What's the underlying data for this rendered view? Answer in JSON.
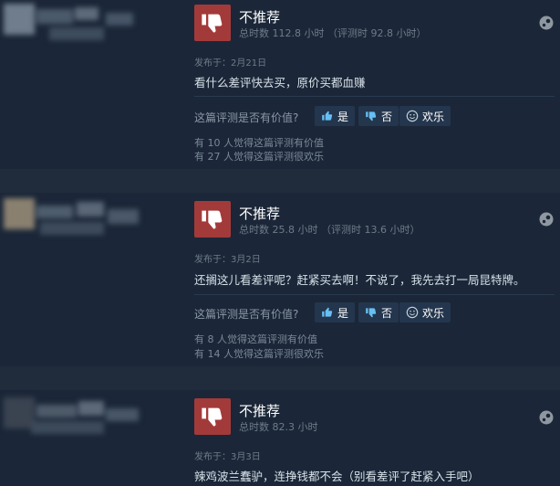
{
  "reviews": [
    {
      "verdict": "不推荐",
      "hours": "总时数 112.8 小时 （评测时 92.8 小时）",
      "posted": "发布于：2月21日",
      "content": "看什么差评快去买，原价买都血赚",
      "helpful_question": "这篇评测是否有价值?",
      "yes_label": "是",
      "no_label": "否",
      "funny_label": "欢乐",
      "helpful_count": "有 10 人觉得这篇评测有价值",
      "funny_count": "有 27 人觉得这篇评测很欢乐"
    },
    {
      "verdict": "不推荐",
      "hours": "总时数 25.8 小时 （评测时 13.6 小时）",
      "posted": "发布于：3月2日",
      "content": "还搁这儿看差评呢？赶紧买去啊！不说了，我先去打一局昆特牌。",
      "helpful_question": "这篇评测是否有价值?",
      "yes_label": "是",
      "no_label": "否",
      "funny_label": "欢乐",
      "helpful_count": "有 8 人觉得这篇评测有价值",
      "funny_count": "有 14 人觉得这篇评测很欢乐"
    },
    {
      "verdict": "不推荐",
      "hours": "总时数 82.3 小时",
      "posted": "发布于：3月3日",
      "content": "辣鸡波兰蠢驴，连挣钱都不会（别看差评了赶紧入手吧）"
    }
  ],
  "colors": {
    "thumb_bg": "#a33a3a",
    "page_bg": "#16202d",
    "card_bg": "#1b2738",
    "button_bg": "#24364d"
  }
}
